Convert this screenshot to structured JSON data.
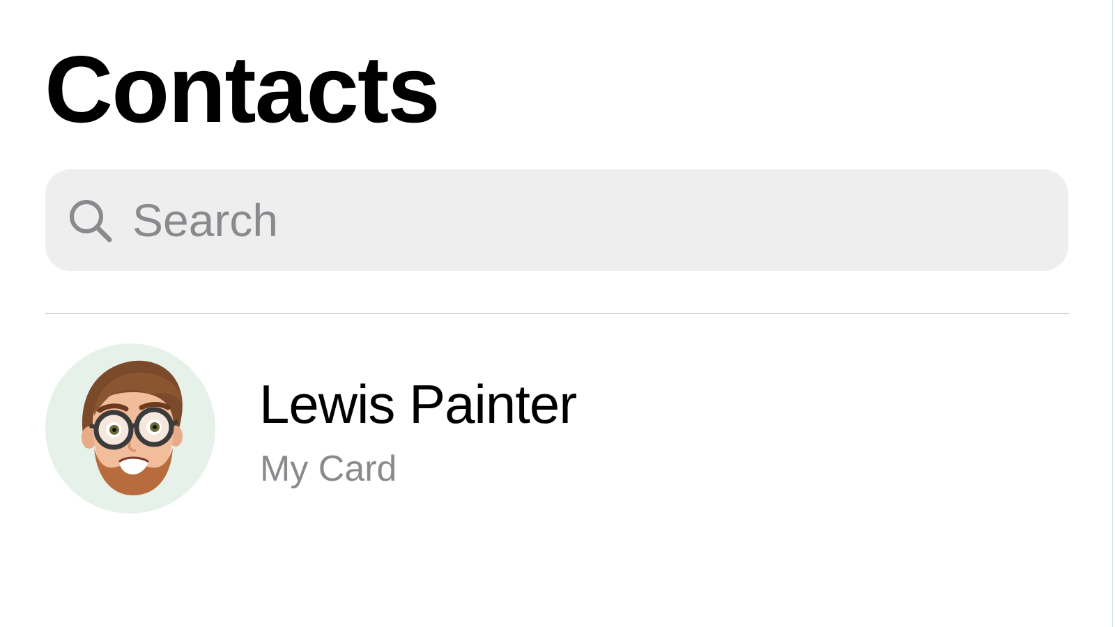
{
  "header": {
    "title": "Contacts"
  },
  "search": {
    "placeholder": "Search",
    "value": "",
    "icon": "search-icon"
  },
  "contacts": [
    {
      "name": "Lewis Painter",
      "subtitle": "My Card",
      "avatar": "memoji-avatar"
    }
  ],
  "colors": {
    "background": "#ffffff",
    "search_field": "#eeeeef",
    "secondary_text": "#8a8a8e",
    "divider": "#d4d4d6",
    "avatar_background": "#e6f1e9"
  }
}
